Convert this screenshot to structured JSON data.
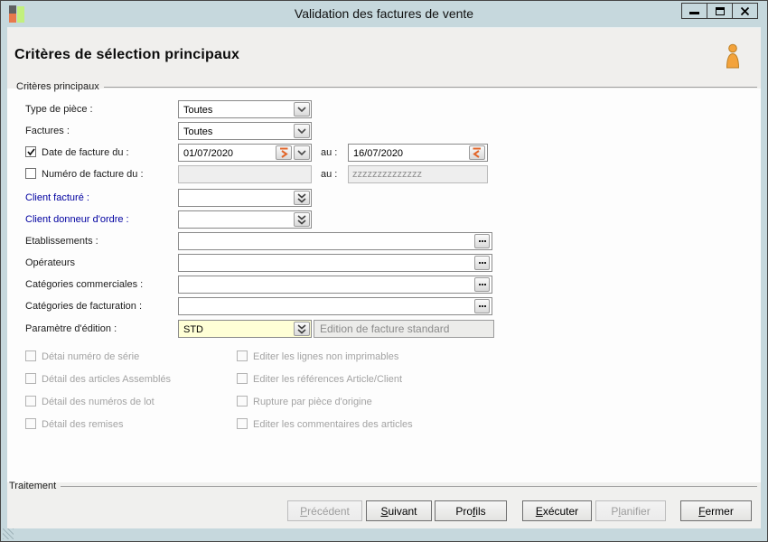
{
  "window": {
    "title": "Validation des factures de vente"
  },
  "header": {
    "title": "Critères de sélection principaux"
  },
  "groups": {
    "main": "Critères principaux",
    "bottom": "Traitement"
  },
  "fields": {
    "type_piece": {
      "label": "Type de pièce :",
      "value": "Toutes"
    },
    "factures": {
      "label": "Factures  :",
      "value": "Toutes"
    },
    "date_facture": {
      "label": "Date de facture du :",
      "from": "01/07/2020",
      "au": "au :",
      "to": "16/07/2020"
    },
    "numero_facture": {
      "label": "Numéro de facture du :",
      "from": "",
      "au": "au :",
      "to": "zzzzzzzzzzzzzz"
    },
    "client_facture": {
      "label": "Client facturé :",
      "value": ""
    },
    "client_donneur": {
      "label": "Client donneur d'ordre :",
      "value": ""
    },
    "etablissements": {
      "label": "Etablissements :",
      "value": ""
    },
    "operateurs": {
      "label": "Opérateurs",
      "value": ""
    },
    "cat_commerciales": {
      "label": "Catégories commerciales :",
      "value": ""
    },
    "cat_facturation": {
      "label": "Catégories de facturation :",
      "value": ""
    },
    "param_edition": {
      "label": "Paramètre d'édition :",
      "value": "STD",
      "description": "Edition de facture standard"
    }
  },
  "options": {
    "left": [
      "Détai numéro de série",
      "Détail des articles Assemblés",
      "Détail des numéros de lot",
      "Détail des remises"
    ],
    "right": [
      "Editer les lignes non imprimables",
      "Editer les références Article/Client",
      "Rupture par pièce d'origine",
      "Editer les commentaires des articles"
    ]
  },
  "buttons": [
    {
      "pre": "",
      "key": "P",
      "post": "récédent",
      "disabled": true
    },
    {
      "pre": "",
      "key": "S",
      "post": "uivant",
      "disabled": false
    },
    {
      "pre": "Pro",
      "key": "f",
      "post": "ils",
      "disabled": false
    },
    {
      "pre": "",
      "key": "E",
      "post": "xécuter",
      "disabled": false
    },
    {
      "pre": "P",
      "key": "l",
      "post": "anifier",
      "disabled": true
    },
    {
      "pre": "",
      "key": "F",
      "post": "ermer",
      "disabled": false
    }
  ],
  "colors": {
    "title_bar": "#c6d8dd",
    "accent_orange": "#e2662a",
    "label_blue": "#0000a0",
    "highlight_yellow": "#ffffd6"
  }
}
